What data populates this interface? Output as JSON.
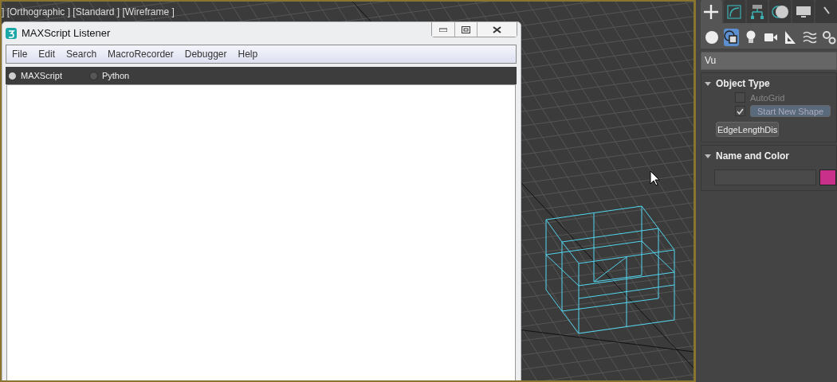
{
  "viewport": {
    "label": "] [Orthographic ] [Standard ] [Wireframe ]"
  },
  "listener": {
    "title": "MAXScript Listener",
    "menu": [
      "File",
      "Edit",
      "Search",
      "MacroRecorder",
      "Debugger",
      "Help"
    ],
    "languages": [
      {
        "label": "MAXScript",
        "selected": true
      },
      {
        "label": "Python",
        "selected": false
      }
    ]
  },
  "command_panel": {
    "tabs": [
      {
        "kind": "create",
        "selected": true
      },
      {
        "kind": "modify",
        "selected": false
      },
      {
        "kind": "hierarchy",
        "selected": false
      },
      {
        "kind": "motion",
        "selected": false
      },
      {
        "kind": "display",
        "selected": false
      },
      {
        "kind": "utilities",
        "selected": false
      }
    ],
    "categories": [
      {
        "kind": "geometry",
        "selected": false
      },
      {
        "kind": "shapes",
        "selected": true
      },
      {
        "kind": "lights",
        "selected": false
      },
      {
        "kind": "cameras",
        "selected": false
      },
      {
        "kind": "helpers",
        "selected": false
      },
      {
        "kind": "spacewarps",
        "selected": false
      },
      {
        "kind": "systems",
        "selected": false
      }
    ],
    "search": {
      "value": "Vu"
    },
    "object_type": {
      "title": "Object Type",
      "autogrid": {
        "label": "AutoGrid",
        "checked": false,
        "disabled": true
      },
      "start_new_shape": {
        "label": "Start New Shape",
        "checked": true
      },
      "buttons": [
        "EdgeLengthDis"
      ]
    },
    "name_and_color": {
      "title": "Name and Color",
      "color": "#c8308a"
    }
  }
}
